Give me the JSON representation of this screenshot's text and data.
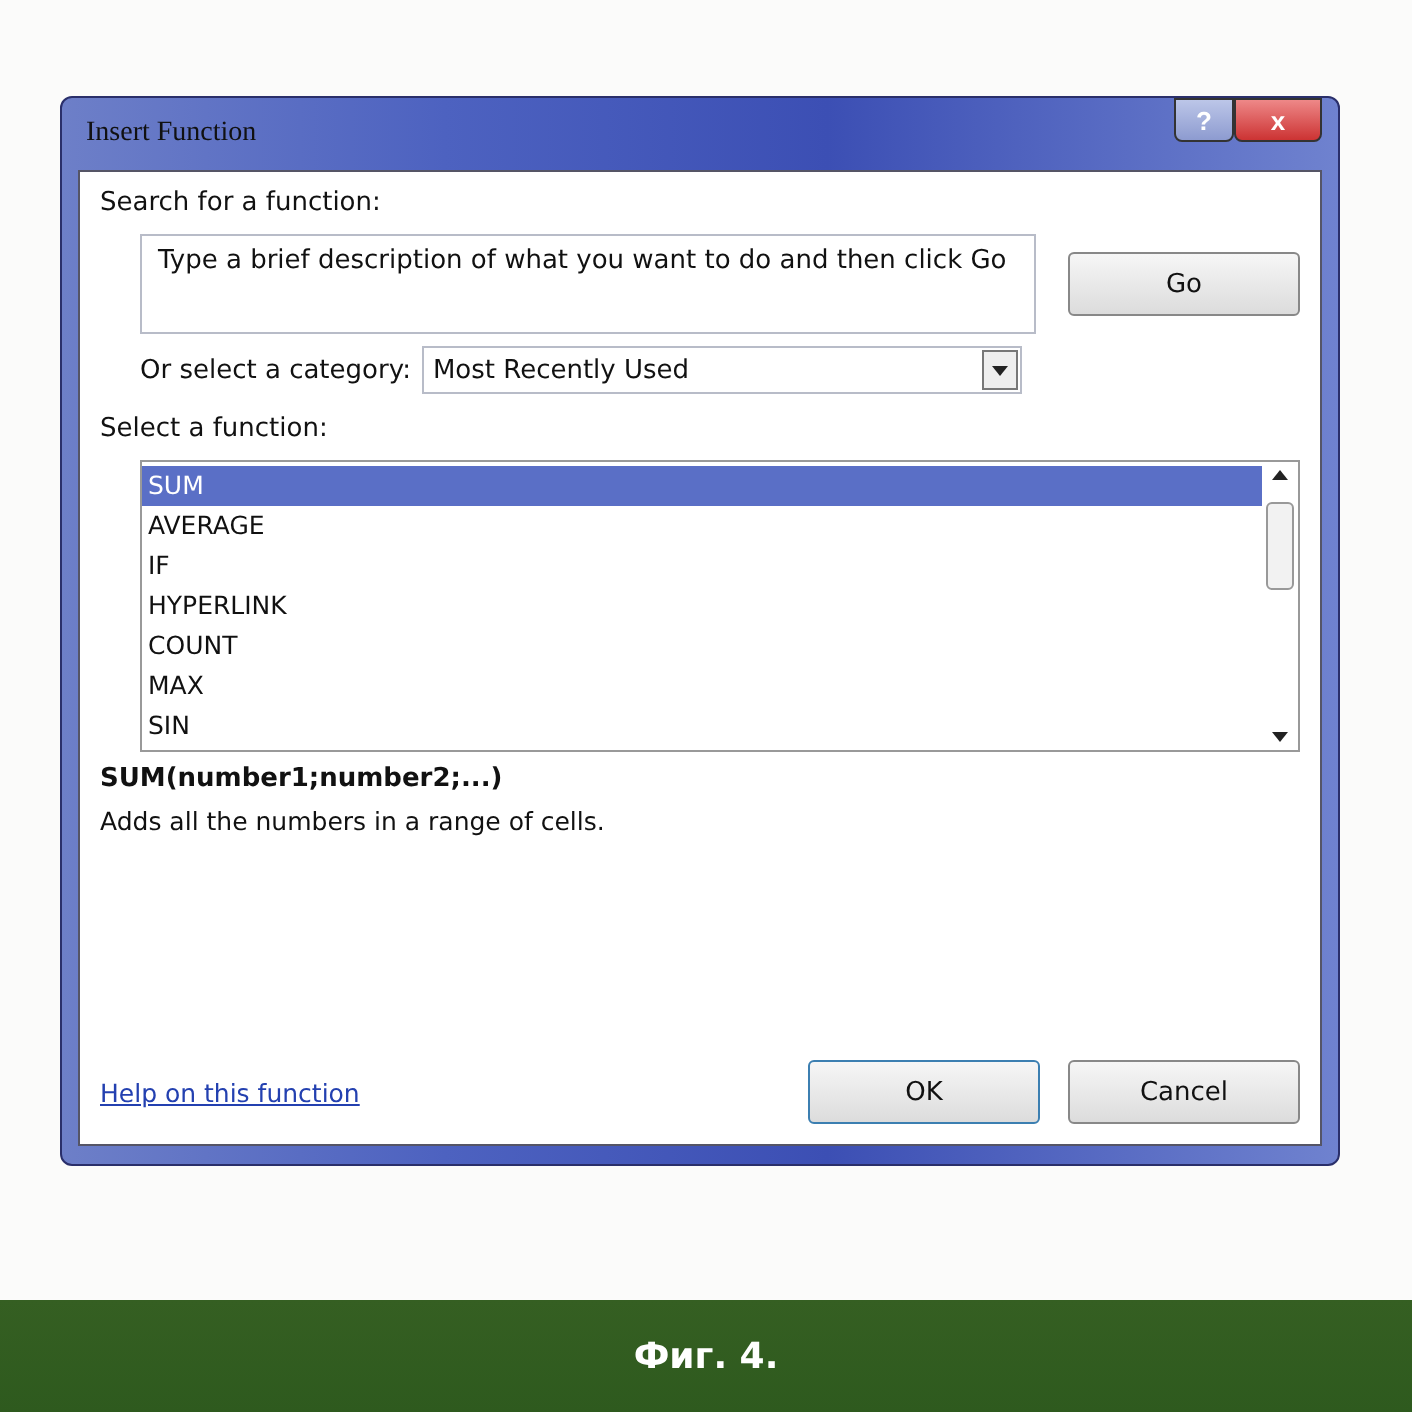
{
  "window": {
    "title": "Insert Function"
  },
  "title_buttons": [
    "?",
    "x"
  ],
  "search": {
    "label": "Search for a function:",
    "value": "Type a brief description of what you want to do and then click Go",
    "button": "Go"
  },
  "category": {
    "label": "Or select a category:",
    "value": "Most Recently Used"
  },
  "functions": {
    "label": "Select a function:",
    "items": [
      {
        "label": "SUM",
        "selected": true
      },
      {
        "label": "AVERAGE",
        "selected": false
      },
      {
        "label": "IF",
        "selected": false
      },
      {
        "label": "HYPERLINK",
        "selected": false
      },
      {
        "label": "COUNT",
        "selected": false
      },
      {
        "label": "MAX",
        "selected": false
      },
      {
        "label": "SIN",
        "selected": false
      }
    ]
  },
  "syntax": "SUM(number1;number2;...)",
  "description": "Adds all the numbers in a range of cells.",
  "help_link": "Help on this function",
  "buttons": [
    "OK",
    "Cancel"
  ],
  "caption": "Фиг. 4."
}
